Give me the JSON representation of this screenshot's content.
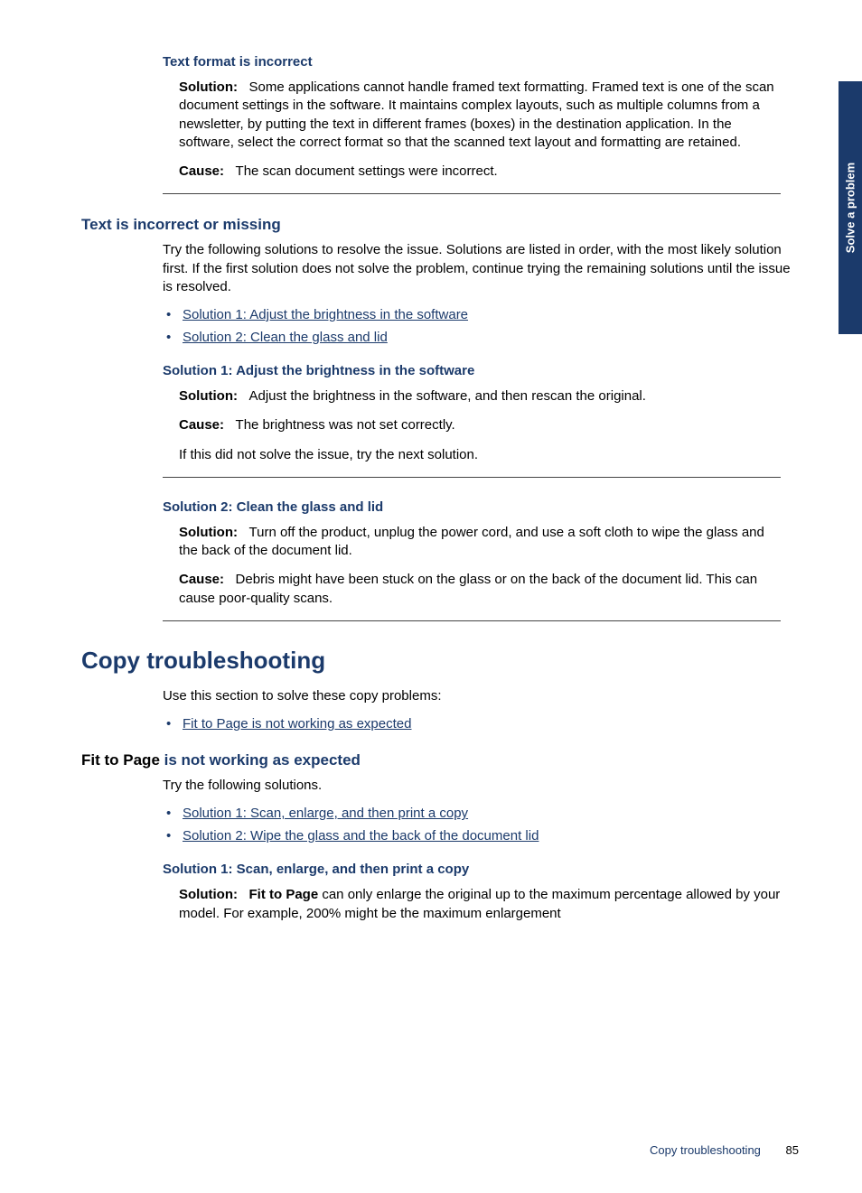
{
  "sideTab": "Solve a problem",
  "sec_textformat": {
    "title": "Text format is incorrect",
    "solution_label": "Solution:",
    "solution_text": "Some applications cannot handle framed text formatting. Framed text is one of the scan document settings in the software. It maintains complex layouts, such as multiple columns from a newsletter, by putting the text in different frames (boxes) in the destination application. In the software, select the correct format so that the scanned text layout and formatting are retained.",
    "cause_label": "Cause:",
    "cause_text": "The scan document settings were incorrect."
  },
  "sec_textincorrect": {
    "title": "Text is incorrect or missing",
    "intro": "Try the following solutions to resolve the issue. Solutions are listed in order, with the most likely solution first. If the first solution does not solve the problem, continue trying the remaining solutions until the issue is resolved.",
    "links": {
      "l1": "Solution 1: Adjust the brightness in the software",
      "l2": "Solution 2: Clean the glass and lid"
    },
    "sol1": {
      "title": "Solution 1: Adjust the brightness in the software",
      "solution_label": "Solution:",
      "solution_text": "Adjust the brightness in the software, and then rescan the original.",
      "cause_label": "Cause:",
      "cause_text": "The brightness was not set correctly.",
      "try_next": "If this did not solve the issue, try the next solution."
    },
    "sol2": {
      "title": "Solution 2: Clean the glass and lid",
      "solution_label": "Solution:",
      "solution_text": "Turn off the product, unplug the power cord, and use a soft cloth to wipe the glass and the back of the document lid.",
      "cause_label": "Cause:",
      "cause_text": "Debris might have been stuck on the glass or on the back of the document lid. This can cause poor-quality scans."
    }
  },
  "sec_copy": {
    "title": "Copy troubleshooting",
    "intro": "Use this section to solve these copy problems:",
    "link1": "Fit to Page is not working as expected"
  },
  "sec_fit": {
    "title_black": "Fit to Page ",
    "title_blue": "is not working as expected",
    "intro": "Try the following solutions.",
    "links": {
      "l1": "Solution 1: Scan, enlarge, and then print a copy",
      "l2": "Solution 2: Wipe the glass and the back of the document lid"
    },
    "sol1": {
      "title": "Solution 1: Scan, enlarge, and then print a copy",
      "solution_label": "Solution:",
      "fit_bold": "Fit to Page",
      "solution_text": " can only enlarge the original up to the maximum percentage allowed by your model. For example, 200% might be the maximum enlargement"
    }
  },
  "footer": {
    "title": "Copy troubleshooting",
    "page": "85"
  }
}
